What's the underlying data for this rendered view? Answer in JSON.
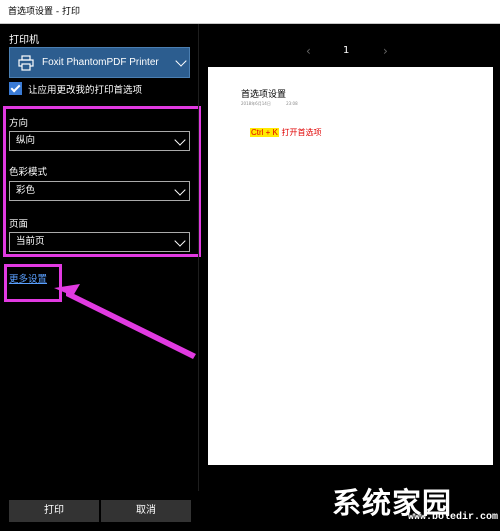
{
  "window": {
    "title": "首选项设置 - 打印"
  },
  "printer": {
    "label": "打印机",
    "selected": "Foxit PhantomPDF Printer",
    "icon": "printer-icon"
  },
  "apply_checkbox": {
    "label": "让应用更改我的打印首选项",
    "checked": true
  },
  "settings": {
    "orientation": {
      "label": "方向",
      "value": "纵向"
    },
    "color_mode": {
      "label": "色彩模式",
      "value": "彩色"
    },
    "pages": {
      "label": "页面",
      "value": "当前页"
    }
  },
  "more_settings": {
    "label": "更多设置"
  },
  "preview": {
    "page_number": "1",
    "prev_glyph": "‹",
    "next_glyph": "›",
    "doc_title": "首选项设置",
    "doc_date": "2018年6月14日",
    "doc_time": "23:08",
    "shortcut": "Ctrl + K",
    "shortcut_text": "打开首选项"
  },
  "buttons": {
    "print": "打印",
    "cancel": "取消"
  },
  "watermark": {
    "text": "系统家园",
    "url": "www.boledir.com"
  },
  "colors": {
    "annotation": "#e13ae1",
    "printer_select_bg": "#2c5d8f",
    "checkbox": "#3a7bd5",
    "link": "#5aa0ff",
    "shortcut_highlight": "#ffea00",
    "shortcut_text": "#e00000"
  }
}
